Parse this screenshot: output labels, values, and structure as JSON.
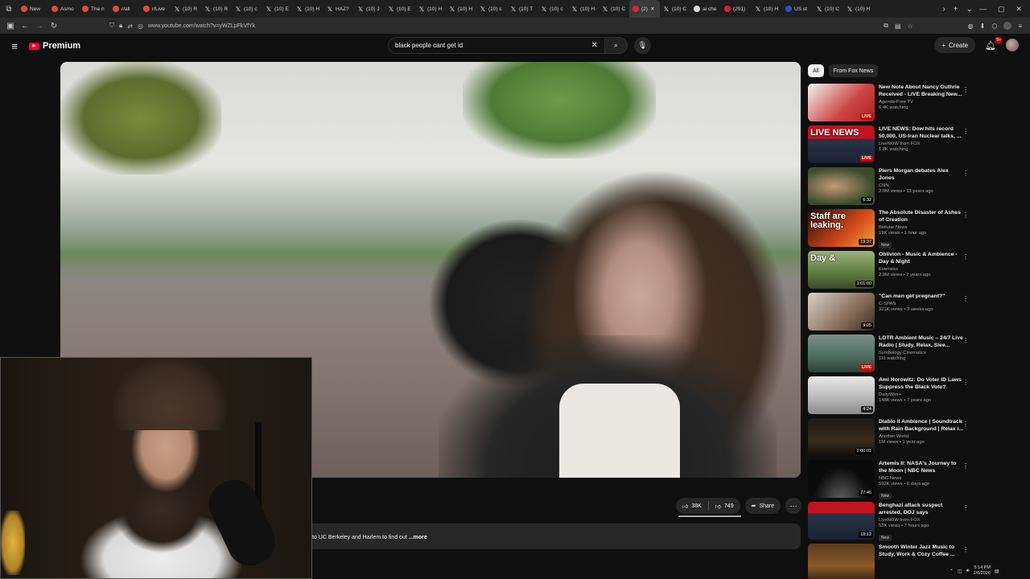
{
  "browser": {
    "tabs": [
      {
        "label": "New",
        "fav": "r"
      },
      {
        "label": "Asmo",
        "fav": "r"
      },
      {
        "label": "The n",
        "fav": "r"
      },
      {
        "label": "r/all",
        "fav": "r"
      },
      {
        "label": "r/Live",
        "fav": "r"
      },
      {
        "label": "(10) R",
        "fav": "x"
      },
      {
        "label": "(10) R",
        "fav": "x"
      },
      {
        "label": "(10) c",
        "fav": "x"
      },
      {
        "label": "(10) E",
        "fav": "x"
      },
      {
        "label": "(10) H",
        "fav": "x"
      },
      {
        "label": "HAZ?",
        "fav": "x"
      },
      {
        "label": "(10) J",
        "fav": "x"
      },
      {
        "label": "(10) E",
        "fav": "x"
      },
      {
        "label": "(10) H",
        "fav": "x"
      },
      {
        "label": "(10) H",
        "fav": "x"
      },
      {
        "label": "(10) c",
        "fav": "x"
      },
      {
        "label": "(10) T",
        "fav": "x"
      },
      {
        "label": "(10) c",
        "fav": "x"
      },
      {
        "label": "(10) H",
        "fav": "x"
      },
      {
        "label": "(10) C",
        "fav": "x"
      },
      {
        "label": "(2)",
        "fav": "yt",
        "active": true
      },
      {
        "label": "(10) C",
        "fav": "x"
      },
      {
        "label": "ai che",
        "fav": "g"
      },
      {
        "label": "(291)",
        "fav": "yt"
      },
      {
        "label": "(10) H",
        "fav": "x"
      },
      {
        "label": "US st",
        "fav": "b"
      },
      {
        "label": "(10) C",
        "fav": "x"
      },
      {
        "label": "(10) H",
        "fav": "x"
      }
    ],
    "url": "www.youtube.com/watch?v=yWZLpFkVfYk"
  },
  "header": {
    "logo_label": "Premium",
    "search_value": "black people cant get id",
    "create_label": "Create",
    "notif_count": "9+"
  },
  "video": {
    "like_count": "38K",
    "dislike_count": "749",
    "share_label": "Share",
    "description": "to UC Berkeley and Harlem to find out",
    "more_label": "...more"
  },
  "sidebar": {
    "chips": [
      {
        "label": "All",
        "active": true
      },
      {
        "label": "From Fox News",
        "active": false
      }
    ],
    "recs": [
      {
        "title": "New Note About Nancy Guthrie Received - LIVE Breaking New...",
        "channel": "Agenda-Free TV",
        "meta": "6.4K watching",
        "badge": "LIVE",
        "thumb_bg": "linear-gradient(135deg,#f5f5f5,#c44 60%,#a22)",
        "overlay": ""
      },
      {
        "title": "LIVE NEWS: Dow hits record 50,000, US-Iran Nuclear talks, ...",
        "channel": "LiveNOW from FOX",
        "meta": "1.8K watching",
        "badge": "LIVE",
        "thumb_bg": "linear-gradient(180deg,#c1121f 0%,#c1121f 35%,#2a3448 36%,#1b2233 100%)",
        "overlay": "LIVE NEWS"
      },
      {
        "title": "Piers Morgan debates Alex Jones",
        "channel": "CNN",
        "meta": "2.9M views • 13 years ago",
        "badge": "6:32",
        "thumb_bg": "radial-gradient(ellipse at 40% 50%,#c49a7a,#3a4a2a 70%)",
        "overlay": ""
      },
      {
        "title": "The Absolute Disaster of Ashes of Creation",
        "channel": "Bellular News",
        "meta": "19K views • 1 hour ago",
        "new": "New",
        "badge": "19:37",
        "thumb_bg": "linear-gradient(135deg,#2a0a0a,#d2491a 60%,#f7a53a)",
        "overlay": "Staff are leaking."
      },
      {
        "title": "Oblivion - Music & Ambience - Day & Night",
        "channel": "Evemess",
        "meta": "2.9M views • 7 years ago",
        "badge": "1:01:00",
        "thumb_bg": "linear-gradient(180deg,#9bb27a,#5d7a3c 60%,#3b4a26)",
        "overlay": "Day &"
      },
      {
        "title": "\"Can men get pregnant?\"",
        "channel": "C-SPAN",
        "meta": "321K views • 3 weeks ago",
        "badge": "9:05",
        "thumb_bg": "linear-gradient(135deg,#d8d2c8,#8a6e5a 60%,#3a2a22)",
        "overlay": ""
      },
      {
        "title": "LOTR Ambient Music – 24/7 Live Radio | Study, Relax, Slee...",
        "channel": "Symbology Cinematics",
        "meta": "111 watching",
        "badge": "LIVE",
        "thumb_bg": "linear-gradient(180deg,#7e8f8a,#4b6b5e 60%,#2f4038)",
        "overlay": ""
      },
      {
        "title": "Ami Horowitz: Do Voter ID Laws Suppress the Black Vote?",
        "channel": "DailyWire+",
        "meta": "148K views • 7 years ago",
        "badge": "4:24",
        "thumb_bg": "linear-gradient(180deg,#e9e9e9,#bfbfbf 50%,#8a8a8a)",
        "overlay": ""
      },
      {
        "title": "Diablo II Ambience | Soundtrack with Rain Background | Relax i...",
        "channel": "Another World",
        "meta": "1M views • 1 year ago",
        "badge": "2:00:01",
        "thumb_bg": "linear-gradient(180deg,#1a1a1a,#3a2a1a 60%,#0f0f0f)",
        "overlay": ""
      },
      {
        "title": "Artemis II: NASA's Journey to the Moon | NBC News",
        "channel": "NBC News",
        "meta": "592K views • 6 days ago",
        "new": "New",
        "badge": "27:45",
        "thumb_bg": "radial-gradient(ellipse at 50% 120%,#6a6a6a,#0a0a0a 60%)",
        "overlay": ""
      },
      {
        "title": "Benghazi attack suspect arrested, DOJ says",
        "channel": "LiveNOW from FOX",
        "meta": "53K views • 7 hours ago",
        "new": "New",
        "badge": "18:12",
        "thumb_bg": "linear-gradient(180deg,#c1121f 0%,#c1121f 30%,#2a3448 31%,#1b2233 100%)",
        "overlay": ""
      },
      {
        "title": "Smooth Winter Jazz Music to Study, Work & Cozy Coffee ...",
        "channel": "",
        "meta": "",
        "badge": "",
        "thumb_bg": "linear-gradient(180deg,#5a3a1a,#8a5a2a 60%,#3a2010)",
        "overlay": ""
      }
    ]
  },
  "taskbar": {
    "time": "5:14 PM",
    "date": "2/6/2026"
  }
}
